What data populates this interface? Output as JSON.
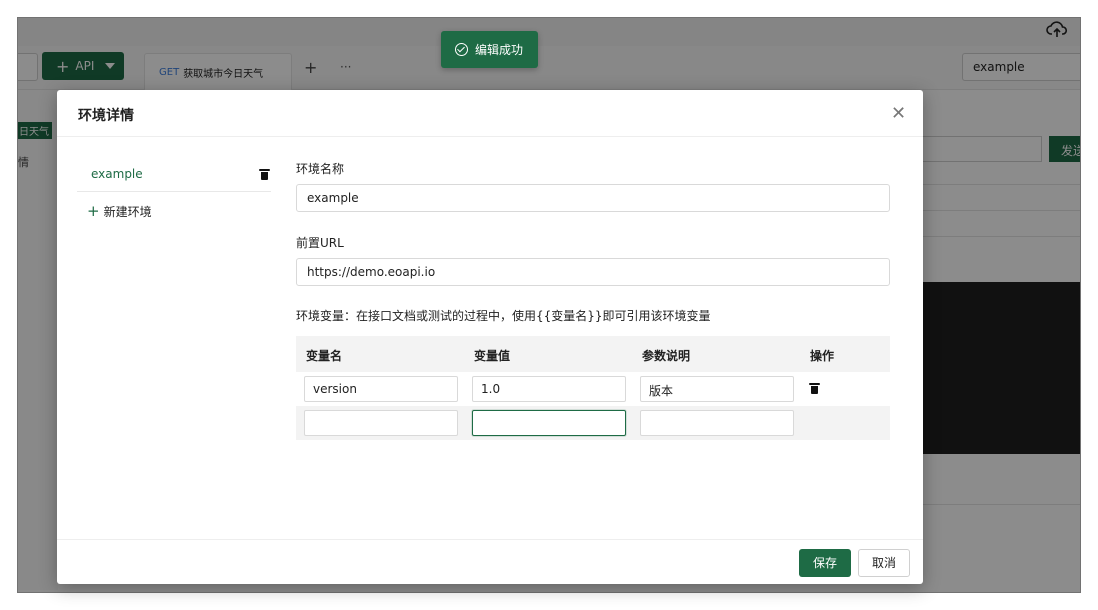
{
  "app": {
    "toolbar": {
      "add_api_label": "API",
      "active_tab": {
        "method": "GET",
        "title": "获取城市今日天气"
      },
      "more_label": "···",
      "environment_selected": "example"
    },
    "left_panel": {
      "item_partial": "日天气",
      "item_partial_2": "情"
    },
    "send_label_partial": "发送"
  },
  "toast": {
    "message": "编辑成功",
    "icon": "check-circle-icon"
  },
  "modal": {
    "title": "环境详情",
    "env_list": [
      {
        "name": "example"
      }
    ],
    "new_env_label": "新建环境",
    "form": {
      "name_label": "环境名称",
      "name_value": "example",
      "url_label": "前置URL",
      "url_value": "https://demo.eoapi.io",
      "vars_description": "环境变量：在接口文档或测试的过程中，使用{{变量名}}即可引用该环境变量",
      "columns": [
        "变量名",
        "变量值",
        "参数说明",
        "操作"
      ],
      "rows": [
        {
          "name": "version",
          "value": "1.0",
          "description": "版本"
        },
        {
          "name": "",
          "value": "",
          "description": ""
        }
      ]
    },
    "footer": {
      "save_label": "保存",
      "cancel_label": "取消"
    }
  },
  "colors": {
    "accent": "#1e6b45",
    "method_get": "#3b7ddd",
    "overlay": "rgba(0,0,0,0.45)"
  }
}
